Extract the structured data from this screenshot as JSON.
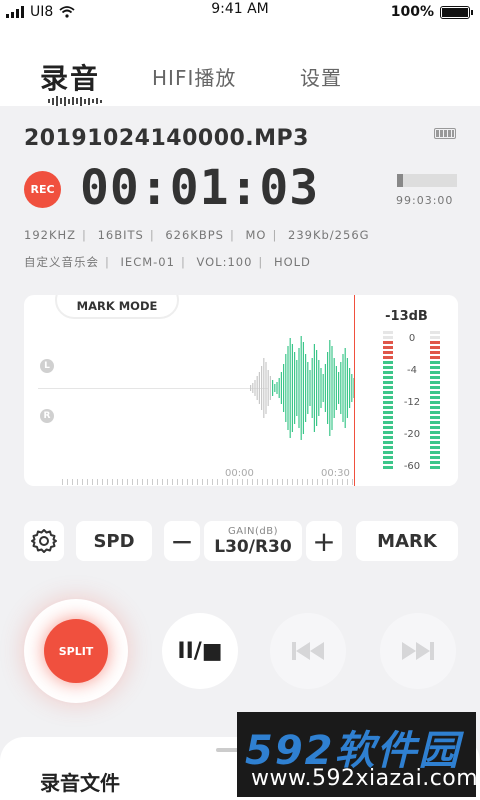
{
  "status_bar": {
    "carrier": "UI8",
    "time": "9:41 AM",
    "battery": "100%"
  },
  "tabs": [
    {
      "label": "录音",
      "active": true
    },
    {
      "label": "HIFI播放",
      "active": false
    },
    {
      "label": "设置",
      "active": false
    }
  ],
  "recording": {
    "filename": "20191024140000.MP3",
    "rec_badge": "REC",
    "elapsed": "00:01:03",
    "storage_used_fraction": 0.1,
    "remaining_time": "99:03:00"
  },
  "specs_line1": [
    "192KHZ",
    "16BITS",
    "626KBPS",
    "MO",
    "239Kb/256G"
  ],
  "specs_line2": [
    "自定义音乐会",
    "IECM-01",
    "VOL:100",
    "HOLD"
  ],
  "waveform": {
    "mark_mode_label": "MARK MODE",
    "channel_left": "L",
    "channel_right": "R",
    "time_start": "00:00",
    "time_end": "00:30",
    "wave_color": "#3cc68a",
    "history_color": "#c8c8c8"
  },
  "meter": {
    "level": "-13dB",
    "scale": [
      "0",
      "-4",
      "-12",
      "-20",
      "-60"
    ],
    "peak_color": "#e0564a",
    "level_color": "#3cc68a"
  },
  "controls": {
    "spd": "SPD",
    "minus": "−",
    "gain_label": "GAIN(dB)",
    "gain_value": "L30/R30",
    "plus": "+",
    "mark": "MARK"
  },
  "transport": {
    "split": "SPLIT",
    "pause_stop": "II/■"
  },
  "bottom_sheet": {
    "title": "录音文件"
  },
  "watermark": {
    "brand": "592软件园",
    "url": "www.592xiazai.com"
  },
  "colors": {
    "accent": "#f0503e",
    "background": "#f1f1f3"
  }
}
